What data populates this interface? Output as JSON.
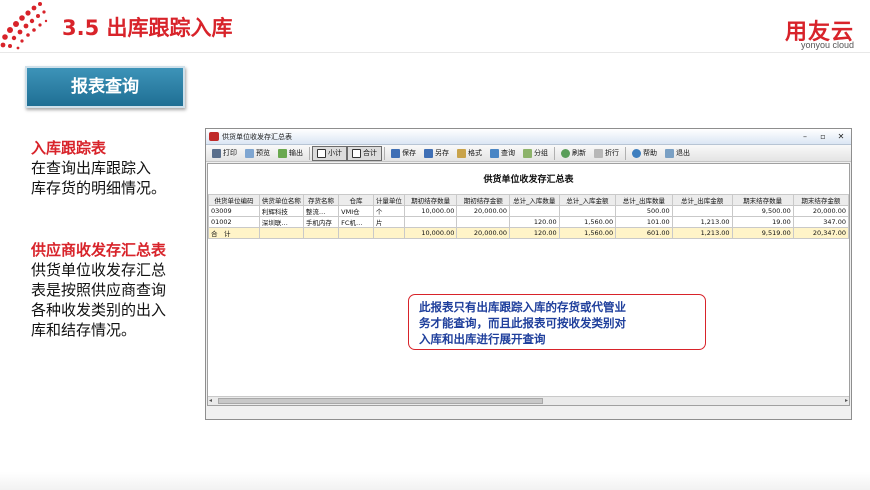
{
  "slide": {
    "title": "3.5 出库跟踪入库",
    "brand_cn": "用友云",
    "brand_en": "yonyou cloud",
    "section_button": "报表查询",
    "accent_color": "#d8232a"
  },
  "left_text": {
    "block1_title": "入库跟踪表",
    "block1_lines": [
      "在查询出库跟踪入",
      "库存货的明细情况。"
    ],
    "block2_title": "供应商收发存汇总表",
    "block2_lines": [
      "供货单位收发存汇总",
      "表是按照供应商查询",
      "各种收发类别的出入",
      "库和结存情况。"
    ]
  },
  "window": {
    "title": "供货单位收发存汇总表",
    "toolbar": [
      "打印",
      "预览",
      "输出",
      "小计",
      "合计",
      "保存",
      "另存",
      "格式",
      "查询",
      "分组",
      "刷新",
      "折行",
      "帮助",
      "退出"
    ],
    "report_title": "供货单位收发存汇总表",
    "columns": [
      "供货单位编码",
      "供货单位名称",
      "存货名称",
      "仓库",
      "计量单位",
      "期初结存数量",
      "期初结存金额",
      "总计_入库数量",
      "总计_入库金额",
      "总计_出库数量",
      "总计_出库金额",
      "期末结存数量",
      "期末结存金额"
    ],
    "rows": [
      [
        "03009",
        "利辉科技",
        "整流…",
        "VMI仓",
        "个",
        "10,000.00",
        "20,000.00",
        "",
        "",
        "500.00",
        "",
        "9,500.00",
        "20,000.00"
      ],
      [
        "01002",
        "深圳联…",
        "手机内存",
        "FC机…",
        "片",
        "",
        "",
        "120.00",
        "1,560.00",
        "101.00",
        "1,213.00",
        "19.00",
        "347.00"
      ],
      [
        "合　计",
        "",
        "",
        "",
        "",
        "10,000.00",
        "20,000.00",
        "120.00",
        "1,560.00",
        "601.00",
        "1,213.00",
        "9,519.00",
        "20,347.00"
      ]
    ]
  },
  "callout_lines": [
    "此报表只有出库跟踪入库的存货或代管业",
    "务才能查询，而且此报表可按收发类别对",
    "入库和出库进行展开查询"
  ]
}
